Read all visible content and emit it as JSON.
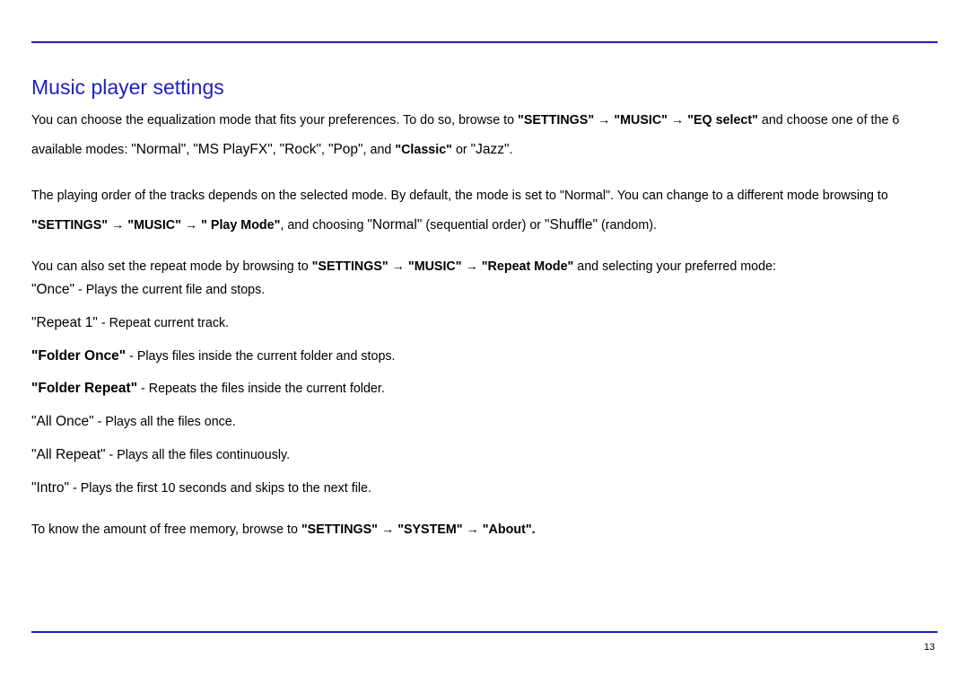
{
  "heading": "Music player settings",
  "p1": {
    "a": "You can choose the equalization mode that fits your preferences.  To do so, browse to ",
    "path": "\"SETTINGS\" → \"MUSIC\" → \"EQ select\"",
    "b": " and choose one of the 6 available modes: ",
    "m1": "\"Normal\"",
    "c1": ", ",
    "m2": "\"MS PlayFX\"",
    "c2": ", ",
    "m3": "\"Rock\"",
    "c3": ", ",
    "m4": "\"Pop\"",
    "c4": ", and ",
    "m5": "\"Classic\"",
    "c5": " or ",
    "m6": "\"Jazz\"",
    "end": "."
  },
  "p2": {
    "a": "The playing order of the tracks depends on the selected mode.  By default, the mode is set to \"Normal\".  You can change to a different mode browsing to ",
    "path": "\"SETTINGS\" → \"MUSIC\" → \" Play Mode\"",
    "b": ", and choosing ",
    "m1": "\"Normal\"",
    "c1": " (sequential order) or ",
    "m2": "\"Shuffle\"",
    "c2": " (random)."
  },
  "p3": {
    "a": "You can also set the repeat mode by browsing to ",
    "path": "\"SETTINGS\" → \"MUSIC\" → \"Repeat Mode\"",
    "b": " and selecting your preferred mode:"
  },
  "modes": [
    {
      "name": "\"Once\"",
      "bold": false,
      "desc": " - Plays the current file and stops."
    },
    {
      "name": "\"Repeat 1\"",
      "bold": false,
      "desc": " - Repeat current track."
    },
    {
      "name": "\"Folder Once\"",
      "bold": true,
      "desc": " - Plays files inside the current folder and stops."
    },
    {
      "name": "\"Folder Repeat\"",
      "bold": true,
      "desc": " - Repeats the files inside the current folder."
    },
    {
      "name": "\"All Once\"",
      "bold": false,
      "desc": " - Plays all the files once."
    },
    {
      "name": "\"All Repeat\"",
      "bold": false,
      "desc": " - Plays all the files continuously."
    },
    {
      "name": "\"Intro\"",
      "bold": false,
      "desc": " - Plays the first 10  seconds and skips to the next file."
    }
  ],
  "p4": {
    "a": "To know the amount of free memory, browse to ",
    "path": "\"SETTINGS\" → \"SYSTEM\" → \"About\"."
  },
  "page_number": "13"
}
